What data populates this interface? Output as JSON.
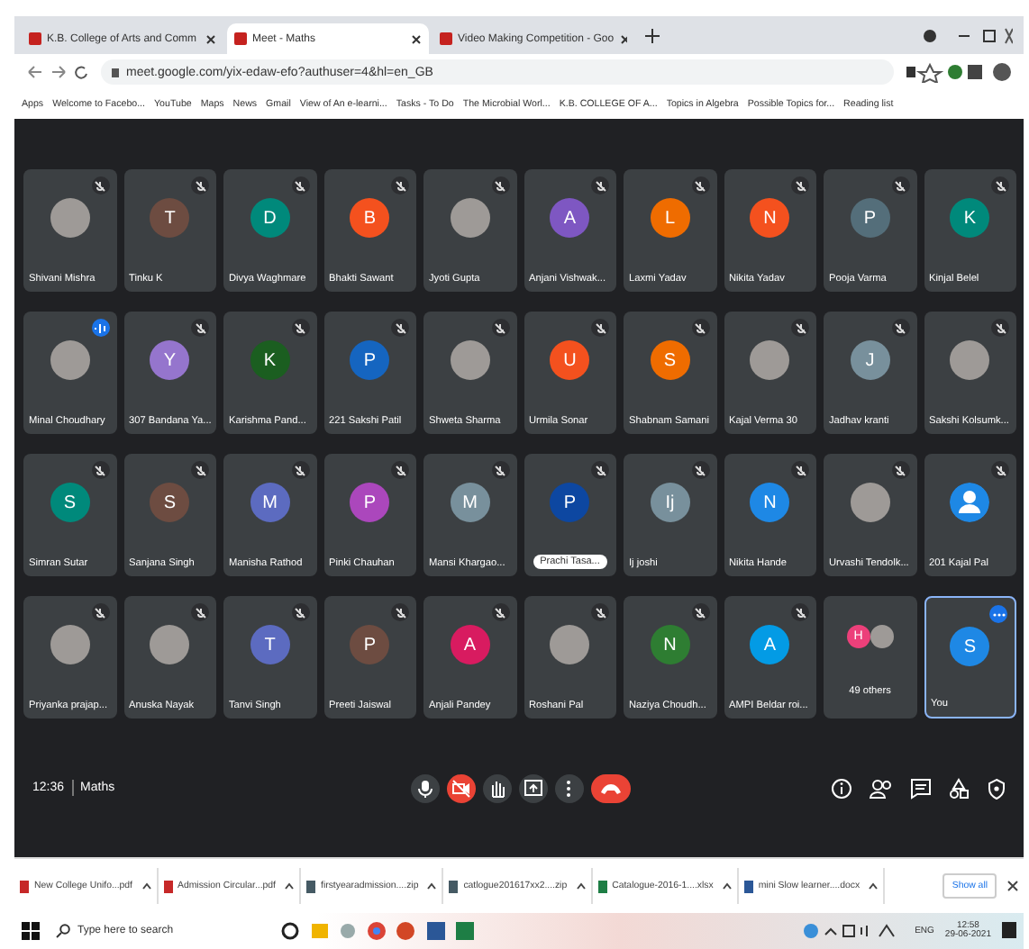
{
  "browser": {
    "tabs": [
      {
        "title": "K.B. College of Arts and Comm",
        "selected": false
      },
      {
        "title": "Meet - Maths",
        "selected": true
      },
      {
        "title": "Video Making Competition - Goo",
        "selected": false
      }
    ],
    "address": "meet.google.com/yix-edaw-efo?authuser=4&hl=en_GB",
    "bookmarks": [
      "Apps",
      "Welcome to Facebo...",
      "YouTube",
      "Maps",
      "News",
      "Gmail",
      "View of An e-learni...",
      "Tasks - To Do",
      "The Microbial Worl...",
      "K.B. COLLEGE OF A...",
      "Topics in Algebra",
      "Possible Topics for...",
      "Reading list"
    ]
  },
  "tiles": [
    {
      "name": "Shivani Mishra",
      "avatar": {
        "kind": "photo"
      },
      "badge": {
        "kind": "muted"
      },
      "selected": false
    },
    {
      "name": "Tinku K",
      "avatar": {
        "kind": "letter",
        "letter": "T",
        "color": "#6d4c41"
      },
      "badge": {
        "kind": "muted"
      },
      "selected": false
    },
    {
      "name": "Divya Waghmare",
      "avatar": {
        "kind": "letter",
        "letter": "D",
        "color": "#00897b"
      },
      "badge": {
        "kind": "muted"
      },
      "selected": false
    },
    {
      "name": "Bhakti Sawant",
      "avatar": {
        "kind": "letter",
        "letter": "B",
        "color": "#f4511e"
      },
      "badge": {
        "kind": "muted"
      },
      "selected": false
    },
    {
      "name": "Jyoti Gupta",
      "avatar": {
        "kind": "photo"
      },
      "badge": {
        "kind": "muted"
      },
      "selected": false
    },
    {
      "name": "Anjani Vishwak...",
      "avatar": {
        "kind": "letter",
        "letter": "A",
        "color": "#7e57c2"
      },
      "badge": {
        "kind": "muted"
      },
      "selected": false
    },
    {
      "name": "Laxmi Yadav",
      "avatar": {
        "kind": "letter",
        "letter": "L",
        "color": "#ef6c00"
      },
      "badge": {
        "kind": "muted"
      },
      "selected": false
    },
    {
      "name": "Nikita Yadav",
      "avatar": {
        "kind": "letter",
        "letter": "N",
        "color": "#f4511e"
      },
      "badge": {
        "kind": "muted"
      },
      "selected": false
    },
    {
      "name": "Pooja Varma",
      "avatar": {
        "kind": "letter",
        "letter": "P",
        "color": "#546e7a"
      },
      "badge": {
        "kind": "muted"
      },
      "selected": false
    },
    {
      "name": "Kinjal Belel",
      "avatar": {
        "kind": "letter",
        "letter": "K",
        "color": "#00897b"
      },
      "badge": {
        "kind": "muted"
      },
      "selected": false
    },
    {
      "name": "Minal Choudhary",
      "avatar": {
        "kind": "photo"
      },
      "badge": {
        "kind": "speaking"
      },
      "selected": false
    },
    {
      "name": "307 Bandana Ya...",
      "avatar": {
        "kind": "letter",
        "letter": "Y",
        "color": "#9575cd"
      },
      "badge": {
        "kind": "muted"
      },
      "selected": false
    },
    {
      "name": "Karishma Pand...",
      "avatar": {
        "kind": "letter",
        "letter": "K",
        "color": "#1b5e20"
      },
      "badge": {
        "kind": "muted"
      },
      "selected": false
    },
    {
      "name": "221 Sakshi Patil",
      "avatar": {
        "kind": "letter",
        "letter": "P",
        "color": "#1565c0"
      },
      "badge": {
        "kind": "muted"
      },
      "selected": false
    },
    {
      "name": "Shweta Sharma",
      "avatar": {
        "kind": "photo"
      },
      "badge": {
        "kind": "muted"
      },
      "selected": false
    },
    {
      "name": "Urmila Sonar",
      "avatar": {
        "kind": "letter",
        "letter": "U",
        "color": "#f4511e"
      },
      "badge": {
        "kind": "muted"
      },
      "selected": false
    },
    {
      "name": "Shabnam Samani",
      "avatar": {
        "kind": "letter",
        "letter": "S",
        "color": "#ef6c00"
      },
      "badge": {
        "kind": "muted"
      },
      "selected": false
    },
    {
      "name": "Kajal Verma 30",
      "avatar": {
        "kind": "photo"
      },
      "badge": {
        "kind": "muted"
      },
      "selected": false
    },
    {
      "name": "Jadhav kranti",
      "avatar": {
        "kind": "letter",
        "letter": "J",
        "color": "#78909c"
      },
      "badge": {
        "kind": "muted"
      },
      "selected": false
    },
    {
      "name": "Sakshi Kolsumk...",
      "avatar": {
        "kind": "photo"
      },
      "badge": {
        "kind": "muted"
      },
      "selected": false
    },
    {
      "name": "Simran Sutar",
      "avatar": {
        "kind": "letter",
        "letter": "S",
        "color": "#00897b"
      },
      "badge": {
        "kind": "muted"
      },
      "selected": false
    },
    {
      "name": "Sanjana Singh",
      "avatar": {
        "kind": "letter",
        "letter": "S",
        "color": "#6d4c41"
      },
      "badge": {
        "kind": "muted"
      },
      "selected": false
    },
    {
      "name": "Manisha Rathod",
      "avatar": {
        "kind": "letter",
        "letter": "M",
        "color": "#5c6bc0"
      },
      "badge": {
        "kind": "muted"
      },
      "selected": false
    },
    {
      "name": "Pinki Chauhan",
      "avatar": {
        "kind": "letter",
        "letter": "P",
        "color": "#ab47bc"
      },
      "badge": {
        "kind": "muted"
      },
      "selected": false
    },
    {
      "name": "Mansi Khargao...",
      "avatar": {
        "kind": "letter",
        "letter": "M",
        "color": "#78909c"
      },
      "badge": {
        "kind": "muted"
      },
      "selected": false
    },
    {
      "name": "Prachi Tasa...",
      "avatar": {
        "kind": "letter",
        "letter": "P",
        "color": "#0d47a1"
      },
      "badge": {
        "kind": "muted"
      },
      "label": {
        "kind": "pill"
      },
      "selected": false
    },
    {
      "name": "Ij joshi",
      "avatar": {
        "kind": "letter",
        "letter": "Ij",
        "color": "#78909c"
      },
      "badge": {
        "kind": "muted"
      },
      "selected": false
    },
    {
      "name": "Nikita Hande",
      "avatar": {
        "kind": "letter",
        "letter": "N",
        "color": "#1e88e5"
      },
      "badge": {
        "kind": "muted"
      },
      "selected": false
    },
    {
      "name": "Urvashi Tendolk...",
      "avatar": {
        "kind": "photo"
      },
      "badge": {
        "kind": "muted"
      },
      "selected": false
    },
    {
      "name": "201 Kajal Pal",
      "avatar": {
        "kind": "person",
        "color": "#1e88e5"
      },
      "badge": {
        "kind": "muted"
      },
      "selected": false
    },
    {
      "name": "Priyanka prajap...",
      "avatar": {
        "kind": "photo"
      },
      "badge": {
        "kind": "muted"
      },
      "selected": false
    },
    {
      "name": "Anuska Nayak",
      "avatar": {
        "kind": "photo"
      },
      "badge": {
        "kind": "muted"
      },
      "selected": false
    },
    {
      "name": "Tanvi Singh",
      "avatar": {
        "kind": "letter",
        "letter": "T",
        "color": "#5c6bc0"
      },
      "badge": {
        "kind": "muted"
      },
      "selected": false
    },
    {
      "name": "Preeti Jaiswal",
      "avatar": {
        "kind": "letter",
        "letter": "P",
        "color": "#6d4c41"
      },
      "badge": {
        "kind": "muted"
      },
      "selected": false
    },
    {
      "name": "Anjali Pandey",
      "avatar": {
        "kind": "letter",
        "letter": "A",
        "color": "#d81b60"
      },
      "badge": {
        "kind": "muted"
      },
      "selected": false
    },
    {
      "name": "Roshani Pal",
      "avatar": {
        "kind": "photo"
      },
      "badge": {
        "kind": "muted"
      },
      "selected": false
    },
    {
      "name": "Naziya Choudh...",
      "avatar": {
        "kind": "letter",
        "letter": "N",
        "color": "#2e7d32"
      },
      "badge": {
        "kind": "muted"
      },
      "selected": false
    },
    {
      "name": "AMPI Beldar roi...",
      "avatar": {
        "kind": "letter",
        "letter": "A",
        "color": "#039be5"
      },
      "badge": {
        "kind": "muted"
      },
      "selected": false
    },
    {
      "name": "49 others",
      "avatar": {
        "kind": "others",
        "letter": "H",
        "color": "#ec407a"
      },
      "selected": false
    },
    {
      "name": "You",
      "avatar": {
        "kind": "letter",
        "letter": "S",
        "color": "#1e88e5"
      },
      "badge": {
        "kind": "more"
      },
      "selected": true
    }
  ],
  "meeting": {
    "time": "12:36",
    "title": "Maths",
    "camera_on": false
  },
  "downloads": {
    "files": [
      {
        "name": "New College Unifo...pdf",
        "kind": "pdf"
      },
      {
        "name": "Admission Circular...pdf",
        "kind": "pdf"
      },
      {
        "name": "firstyearadmission....zip",
        "kind": "zip"
      },
      {
        "name": "catlogue201617xx2....zip",
        "kind": "zip"
      },
      {
        "name": "Catalogue-2016-1....xlsx",
        "kind": "xlsx"
      },
      {
        "name": "mini Slow learner....docx",
        "kind": "docx"
      }
    ],
    "show_all": "Show all"
  },
  "taskbar": {
    "search_placeholder": "Type here to search",
    "language": "ENG",
    "time": "12:58",
    "date": "29-06-2021"
  }
}
